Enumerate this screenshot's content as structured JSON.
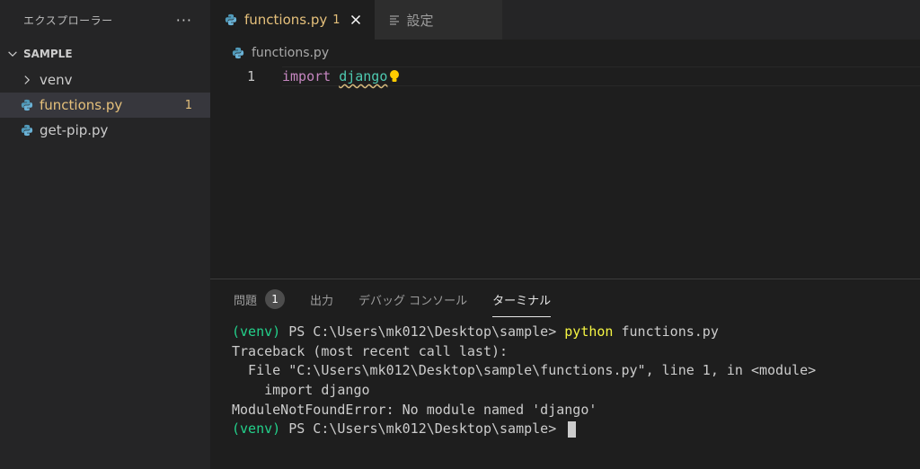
{
  "sidebar": {
    "title": "エクスプローラー",
    "more_icon": "more-icon",
    "section_title": "SAMPLE",
    "items": [
      {
        "label": "venv",
        "icon": "chevron-right-icon"
      },
      {
        "label": "functions.py",
        "icon": "python-icon",
        "badge": "1"
      },
      {
        "label": "get-pip.py",
        "icon": "python-icon"
      }
    ]
  },
  "editor": {
    "tabs": [
      {
        "label": "functions.py",
        "badge": "1",
        "icon": "python-icon"
      },
      {
        "label": "設定",
        "icon": "settings-list-icon"
      }
    ],
    "breadcrumb": "functions.py",
    "line_number": "1",
    "code_keyword": "import",
    "code_module": "django"
  },
  "panel": {
    "tabs": [
      {
        "label": "問題",
        "count": "1"
      },
      {
        "label": "出力"
      },
      {
        "label": "デバッグ コンソール"
      },
      {
        "label": "ターミナル"
      }
    ],
    "terminal": {
      "line1_venv": "(venv)",
      "line1_prompt": " PS C:\\Users\\mk012\\Desktop\\sample> ",
      "line1_cmd": "python",
      "line1_arg": " functions.py",
      "line2": "Traceback (most recent call last):",
      "line3": "  File \"C:\\Users\\mk012\\Desktop\\sample\\functions.py\", line 1, in <module>",
      "line4": "    import django",
      "line5": "ModuleNotFoundError: No module named 'django'",
      "line6_venv": "(venv)",
      "line6_prompt": " PS C:\\Users\\mk012\\Desktop\\sample> "
    }
  },
  "colors": {
    "warning": "#e5c07b",
    "keyword": "#c586c0",
    "module": "#4ec9b0",
    "venv": "#23d18b",
    "command": "#f5f543"
  }
}
